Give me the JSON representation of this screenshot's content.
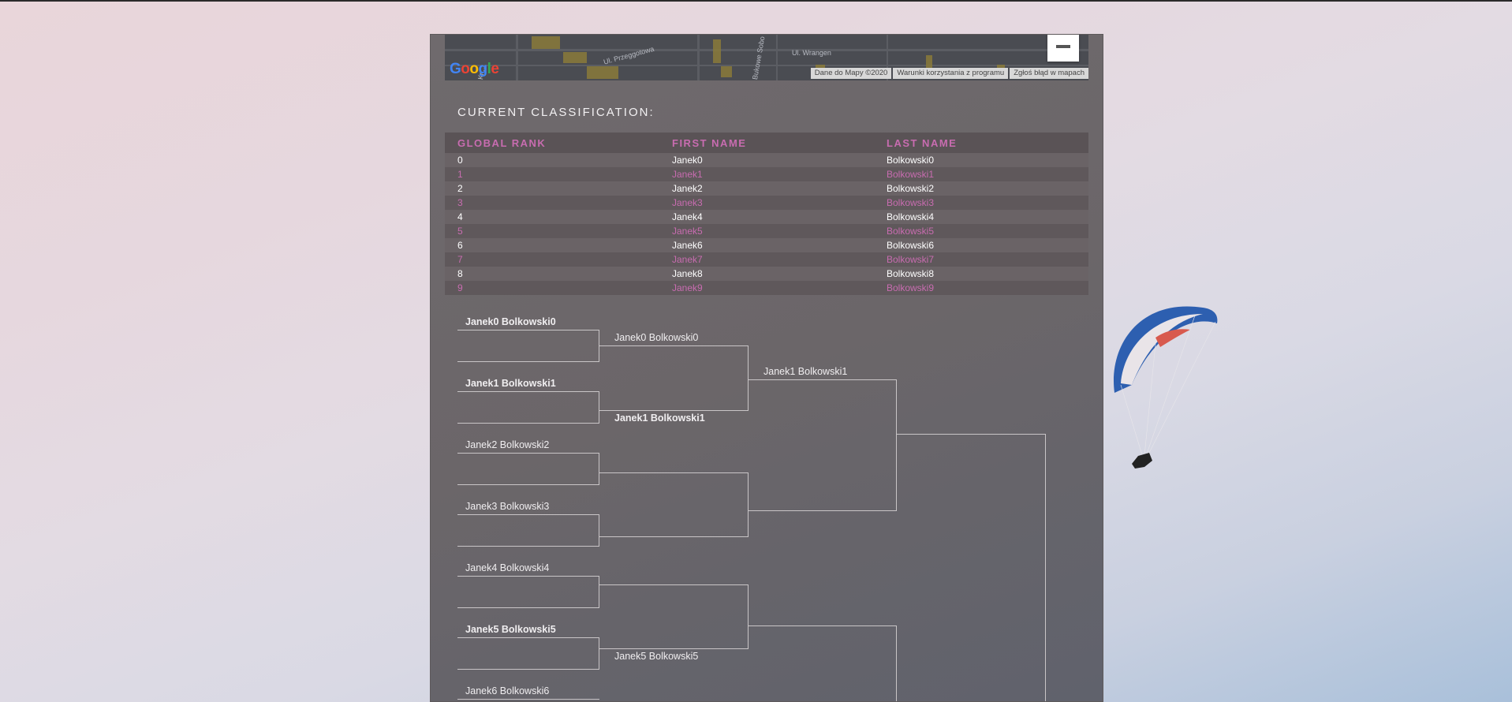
{
  "map": {
    "attribution": [
      "Dane do Mapy ©2020",
      "Warunki korzystania z programu",
      "Zgłoś błąd w mapach"
    ],
    "logo": "Google",
    "zoom_out_icon": "minus-icon",
    "streets": [
      "Kr...",
      "Ul. Przeggotowa",
      "Ul. Wrangen",
      "Bukowe Sobo"
    ]
  },
  "classification": {
    "title": "CURRENT CLASSIFICATION:",
    "columns": [
      "GLOBAL RANK",
      "FIRST NAME",
      "LAST NAME"
    ],
    "rows": [
      [
        "0",
        "Janek0",
        "Bolkowski0"
      ],
      [
        "1",
        "Janek1",
        "Bolkowski1"
      ],
      [
        "2",
        "Janek2",
        "Bolkowski2"
      ],
      [
        "3",
        "Janek3",
        "Bolkowski3"
      ],
      [
        "4",
        "Janek4",
        "Bolkowski4"
      ],
      [
        "5",
        "Janek5",
        "Bolkowski5"
      ],
      [
        "6",
        "Janek6",
        "Bolkowski6"
      ],
      [
        "7",
        "Janek7",
        "Bolkowski7"
      ],
      [
        "8",
        "Janek8",
        "Bolkowski8"
      ],
      [
        "9",
        "Janek9",
        "Bolkowski9"
      ]
    ],
    "colors": {
      "accent": "#c86cb0",
      "text": "#ffffff"
    }
  },
  "bracket": {
    "round1": [
      {
        "name": "Janek0 Bolkowski0",
        "winner": true
      },
      {
        "name": "Janek1 Bolkowski1",
        "winner": true
      },
      {
        "name": "Janek2 Bolkowski2",
        "winner": false
      },
      {
        "name": "Janek3 Bolkowski3",
        "winner": false
      },
      {
        "name": "Janek4 Bolkowski4",
        "winner": false
      },
      {
        "name": "Janek5 Bolkowski5",
        "winner": true
      },
      {
        "name": "Janek6 Bolkowski6",
        "winner": false
      }
    ],
    "round2": [
      {
        "name": "Janek0 Bolkowski0",
        "winner": false
      },
      {
        "name": "Janek1 Bolkowski1",
        "winner": true
      },
      {
        "name": "Janek5 Bolkowski5",
        "winner": false
      }
    ],
    "round3": [
      {
        "name": "Janek1 Bolkowski1",
        "winner": false
      }
    ]
  }
}
